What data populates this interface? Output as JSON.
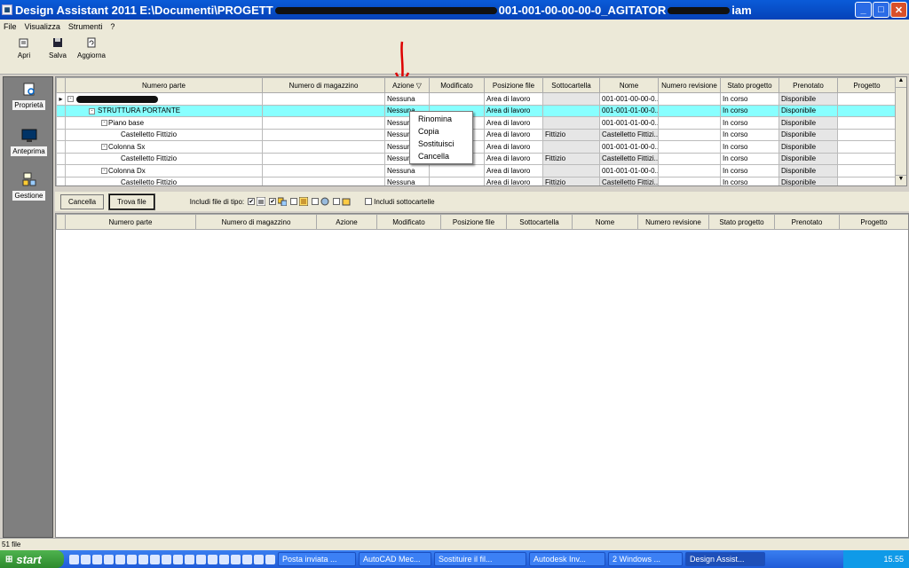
{
  "window": {
    "title_prefix": "Design Assistant 2011 E:\\Documenti\\PROGETT",
    "title_middle": "001-001-00-00-00-0_AGITATOR",
    "title_suffix": "iam",
    "min": "_",
    "max": "□",
    "close": "✕"
  },
  "menu": [
    "File",
    "Visualizza",
    "Strumenti",
    "?"
  ],
  "toolbar": {
    "open": "Apri",
    "save": "Salva",
    "refresh": "Aggiorna"
  },
  "sidebar": {
    "properties": "Proprietà",
    "preview": "Anteprima",
    "management": "Gestione"
  },
  "top_grid": {
    "columns": [
      "Numero parte",
      "Numero di magazzino",
      "Azione",
      "Modificato",
      "Posizione file",
      "Sottocartella",
      "Nome",
      "Numero revisione",
      "Stato progetto",
      "Prenotato",
      "Progetto"
    ],
    "rows": [
      {
        "part": "",
        "action": "Nessuna",
        "pos": "Area di lavoro",
        "sub": "",
        "name": "001-001-00-00-0...",
        "state": "In corso",
        "res": "Disponibile"
      },
      {
        "part": "STRUTTURA PORTANTE",
        "action": "Nessuna",
        "pos": "Area di lavoro",
        "sub": "",
        "name": "001-001-01-00-0...",
        "state": "In corso",
        "res": "Disponibile"
      },
      {
        "part": "Piano base",
        "action": "Nessuna",
        "pos": "Area di lavoro",
        "sub": "",
        "name": "001-001-01-00-0...",
        "state": "In corso",
        "res": "Disponibile"
      },
      {
        "part": "Castelletto Fittizio",
        "action": "Nessuna",
        "pos": "Area di lavoro",
        "sub": "Fittizio",
        "name": "Castelletto Fittizi...",
        "state": "In corso",
        "res": "Disponibile"
      },
      {
        "part": "Colonna Sx",
        "action": "Nessuna",
        "pos": "Area di lavoro",
        "sub": "",
        "name": "001-001-01-00-0...",
        "state": "In corso",
        "res": "Disponibile"
      },
      {
        "part": "Castelletto Fittizio",
        "action": "Nessuna",
        "pos": "Area di lavoro",
        "sub": "Fittizio",
        "name": "Castelletto Fittizi...",
        "state": "In corso",
        "res": "Disponibile"
      },
      {
        "part": "Colonna Dx",
        "action": "Nessuna",
        "pos": "Area di lavoro",
        "sub": "",
        "name": "001-001-01-00-0...",
        "state": "In corso",
        "res": "Disponibile"
      },
      {
        "part": "Castelletto Fittizio",
        "action": "Nessuna",
        "pos": "Area di lavoro",
        "sub": "Fittizio",
        "name": "Castelletto Fittizi...",
        "state": "In corso",
        "res": "Disponibile"
      }
    ]
  },
  "context_menu": [
    "Rinomina",
    "Copia",
    "Sostituisci",
    "Cancella"
  ],
  "search_bar": {
    "cancel": "Cancella",
    "find": "Trova file",
    "include_types": "Includi file di tipo:",
    "include_subfolders": "Includi sottocartelle",
    "check": "✔"
  },
  "bottom_grid": {
    "columns": [
      "Numero parte",
      "Numero di magazzino",
      "Azione",
      "Modificato",
      "Posizione file",
      "Sottocartella",
      "Nome",
      "Numero revisione",
      "Stato progetto",
      "Prenotato",
      "Progetto"
    ]
  },
  "status": {
    "count": "51 file"
  },
  "taskbar": {
    "start": "start",
    "tasks": [
      "Posta inviata ...",
      "AutoCAD Mec...",
      "Sostituire il fil...",
      "Autodesk Inv...",
      "2 Windows ...",
      "Design Assist..."
    ],
    "time": "15.55"
  }
}
